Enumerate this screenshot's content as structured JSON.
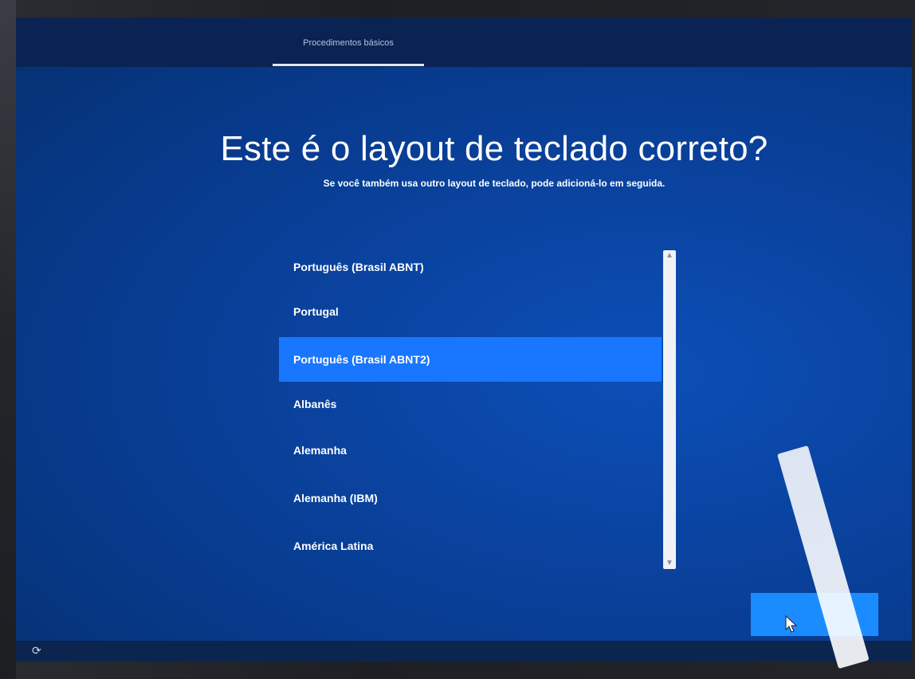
{
  "header": {
    "tab_label": "Procedimentos básicos"
  },
  "main": {
    "title": "Este é o layout de teclado correto?",
    "subtitle": "Se você também usa outro layout de teclado, pode adicioná-lo em seguida."
  },
  "keyboard_list": {
    "items": [
      "Português (Brasil ABNT)",
      "Portugal",
      "Português (Brasil ABNT2)",
      "Albanês",
      "Alemanha",
      "Alemanha (IBM)",
      "América Latina"
    ],
    "selected": "Português (Brasil ABNT2)"
  },
  "icons": {
    "scroll_up": "chevron-up-icon",
    "scroll_down": "chevron-down-icon",
    "accessibility": "accessibility-icon",
    "cursor": "mouse-pointer-icon"
  },
  "colors": {
    "background": "#0a43a0",
    "selected": "#1976ff",
    "button": "#1b8cff"
  }
}
